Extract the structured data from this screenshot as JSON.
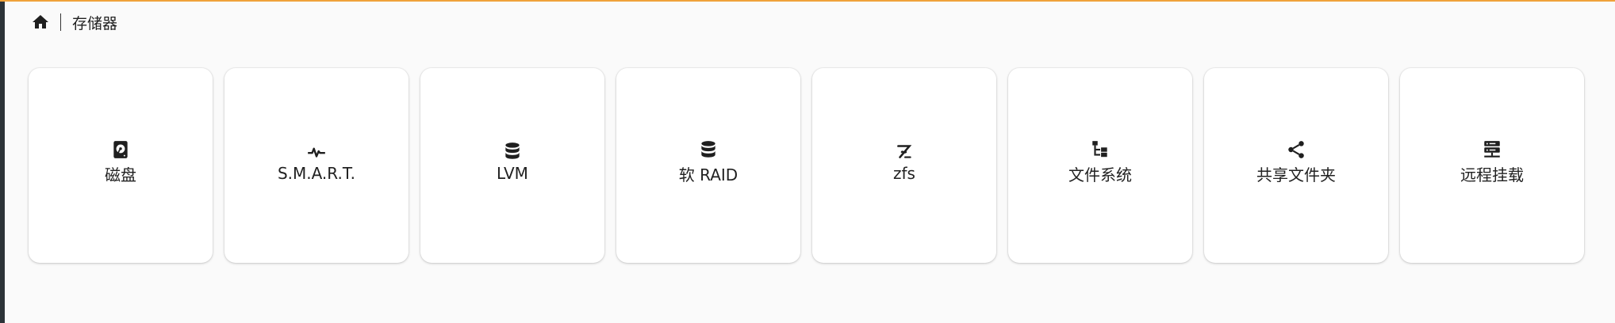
{
  "breadcrumb": {
    "home_icon": "home-icon",
    "current": "存储器"
  },
  "tiles": [
    {
      "label": "磁盘",
      "icon": "harddisk-icon"
    },
    {
      "label": "S.M.A.R.T.",
      "icon": "pulse-icon"
    },
    {
      "label": "LVM",
      "icon": "database-icon"
    },
    {
      "label": "软 RAID",
      "icon": "database-icon"
    },
    {
      "label": "zfs",
      "icon": "zfs-icon"
    },
    {
      "label": "文件系统",
      "icon": "file-tree-icon"
    },
    {
      "label": "共享文件夹",
      "icon": "share-icon"
    },
    {
      "label": "远程挂载",
      "icon": "server-network-icon"
    }
  ],
  "colors": {
    "accent_top_border": "#f0a23a",
    "background": "#fafafa",
    "tile": "#ffffff",
    "left_bar": "#2c3338"
  }
}
